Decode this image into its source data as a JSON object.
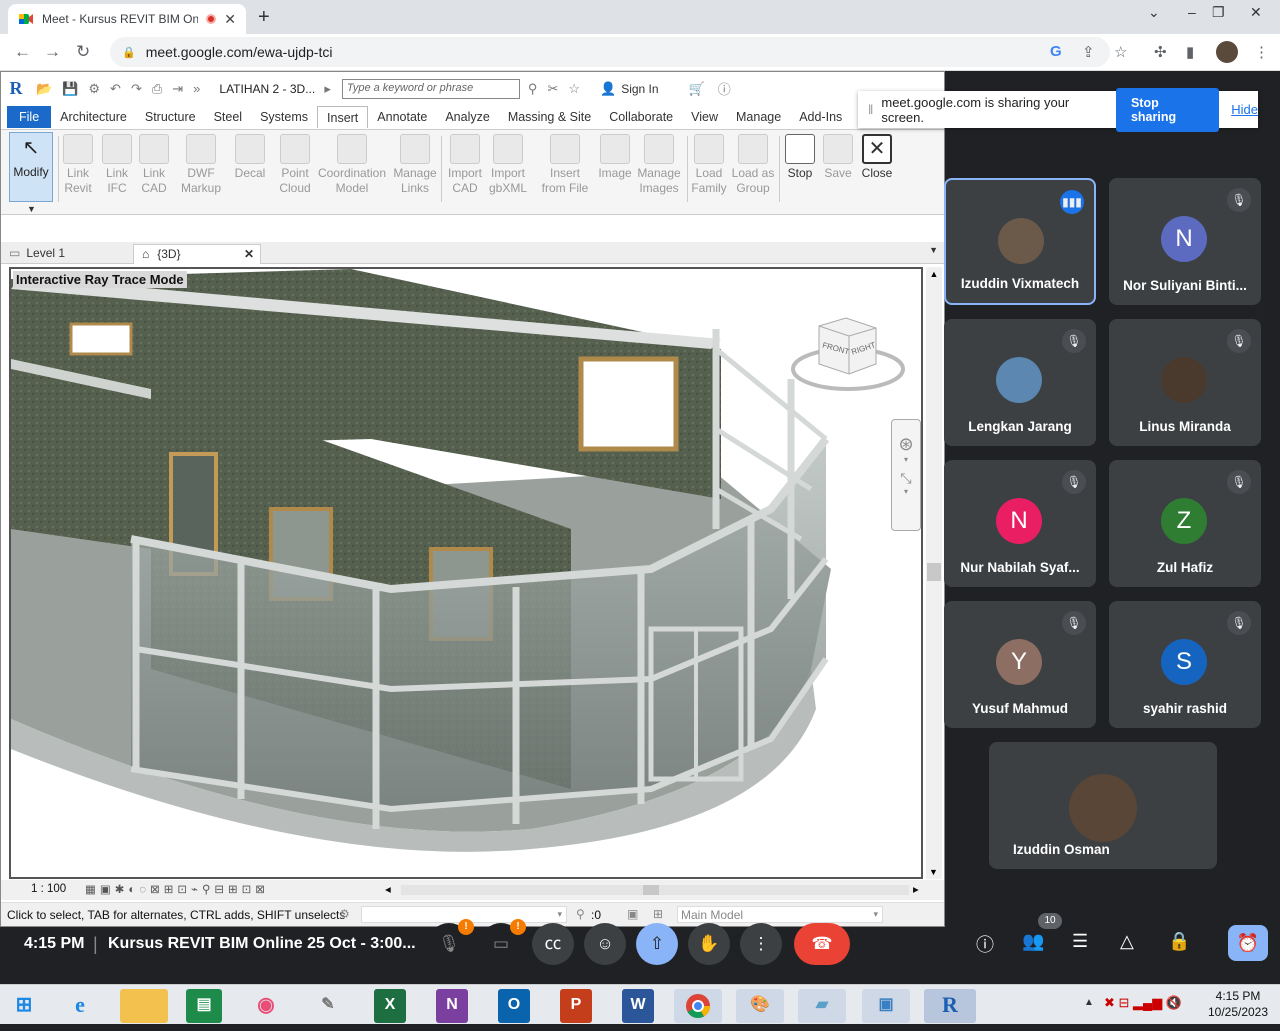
{
  "browser": {
    "tab_title": "Meet - Kursus REVIT BIM Onlin",
    "new_tab": "+",
    "url": "meet.google.com/ewa-ujdp-tci",
    "window_controls": [
      "⌄",
      "–",
      "❐",
      "✕"
    ]
  },
  "revit": {
    "logo": "R",
    "doc_title": "LATIHAN 2 - 3D...",
    "search_placeholder": "Type a keyword or phrase",
    "sign_in": "Sign In",
    "ribbon_tabs": [
      "File",
      "Architecture",
      "Structure",
      "Steel",
      "Systems",
      "Insert",
      "Annotate",
      "Analyze",
      "Massing & Site",
      "Collaborate",
      "View",
      "Manage",
      "Add-Ins"
    ],
    "selected_tab": "Insert",
    "modify": "Modify",
    "ribbon_buttons": [
      {
        "l1": "Link",
        "l2": "Revit"
      },
      {
        "l1": "Link",
        "l2": "IFC"
      },
      {
        "l1": "Link",
        "l2": "CAD"
      },
      {
        "l1": "DWF",
        "l2": "Markup"
      },
      {
        "l1": "Decal",
        "l2": ""
      },
      {
        "l1": "Point",
        "l2": "Cloud"
      },
      {
        "l1": "Coordination",
        "l2": "Model"
      },
      {
        "l1": "Manage",
        "l2": "Links"
      },
      {
        "l1": "Import",
        "l2": "CAD"
      },
      {
        "l1": "Import",
        "l2": "gbXML"
      },
      {
        "l1": "Insert",
        "l2": "from File"
      },
      {
        "l1": "Image",
        "l2": ""
      },
      {
        "l1": "Manage",
        "l2": "Images"
      },
      {
        "l1": "Load",
        "l2": "Family"
      },
      {
        "l1": "Load as",
        "l2": "Group"
      }
    ],
    "stop": "Stop",
    "save": "Save",
    "close": "Close",
    "view_tabs": [
      {
        "label": "Level 1"
      },
      {
        "label": "{3D}"
      }
    ],
    "mode_label": "Interactive Ray Trace Mode",
    "viewcube": {
      "front": "FRONT",
      "right": "RIGHT"
    },
    "scale": "1 : 100",
    "status_text": "Click to select, TAB for alternates, CTRL adds, SHIFT unselects",
    "filter_count": ":0",
    "model_select": "Main Model"
  },
  "share_banner": {
    "message": "meet.google.com is sharing your screen.",
    "stop_label": "Stop sharing",
    "hide_label": "Hide"
  },
  "participants": [
    {
      "name": "Izuddin Vixmatech",
      "initial": "",
      "color": "#6b5a4a",
      "speaking": true
    },
    {
      "name": "Nor Suliyani Binti...",
      "initial": "N",
      "color": "#5c6bc0",
      "speaking": false
    },
    {
      "name": "Lengkan Jarang",
      "initial": "",
      "color": "#5b87b0",
      "speaking": false
    },
    {
      "name": "Linus Miranda",
      "initial": "",
      "color": "#4a3a2e",
      "speaking": false
    },
    {
      "name": "Nur Nabilah Syaf...",
      "initial": "N",
      "color": "#e91e63",
      "speaking": false
    },
    {
      "name": "Zul Hafiz",
      "initial": "Z",
      "color": "#2e7d32",
      "speaking": false
    },
    {
      "name": "Yusuf Mahmud",
      "initial": "Y",
      "color": "#8d6e63",
      "speaking": false
    },
    {
      "name": "syahir rashid",
      "initial": "S",
      "color": "#1565c0",
      "speaking": false
    },
    {
      "name": "Izuddin Osman",
      "initial": "",
      "color": "#5a4636",
      "speaking": false
    }
  ],
  "meet": {
    "time": "4:15 PM",
    "meeting_title": "Kursus REVIT BIM Online 25 Oct - 3:00...",
    "people_count": "10",
    "alert": "!"
  },
  "taskbar": {
    "clock_time": "4:15 PM",
    "clock_date": "10/25/2023",
    "apps": [
      "ie",
      "explorer",
      "excel-green",
      "chrome-color",
      "paper",
      "X",
      "N",
      "O",
      "P",
      "W",
      "chrome",
      "paint",
      "notepad",
      "photos",
      "R"
    ]
  }
}
